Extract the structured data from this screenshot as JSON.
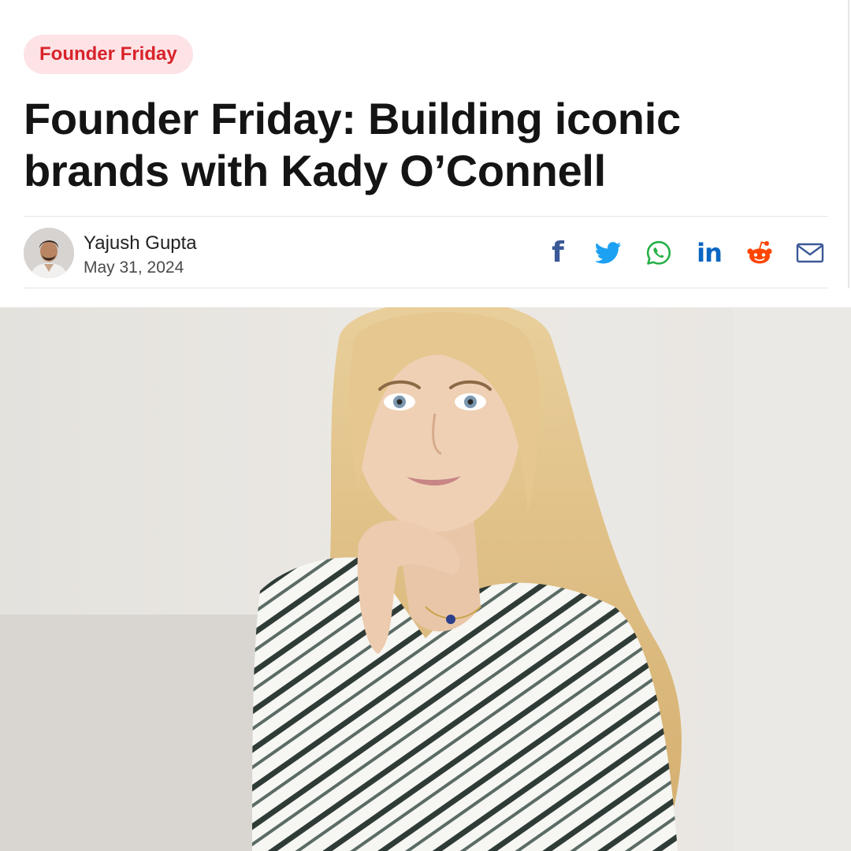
{
  "article": {
    "category": "Founder Friday",
    "headline": "Founder Friday: Building iconic brands with Kady O’Connell",
    "author": {
      "name": "Yajush Gupta",
      "date": "May 31, 2024",
      "avatar_icon": "author-photo"
    }
  },
  "share": {
    "items": [
      {
        "network": "facebook",
        "icon": "facebook-icon",
        "color": "#3b5998"
      },
      {
        "network": "twitter",
        "icon": "twitter-icon",
        "color": "#1da1f2"
      },
      {
        "network": "whatsapp",
        "icon": "whatsapp-icon",
        "color": "#25b047"
      },
      {
        "network": "linkedin",
        "icon": "linkedin-icon",
        "color": "#0a66c2"
      },
      {
        "network": "reddit",
        "icon": "reddit-icon",
        "color": "#ff4500"
      },
      {
        "network": "email",
        "icon": "mail-icon",
        "color": "#3b5998"
      }
    ]
  },
  "hero_image": {
    "subject": "portrait photo"
  },
  "theme": {
    "accent": "#d8232a",
    "tag_background": "#fde3e6",
    "text": "#141414"
  }
}
